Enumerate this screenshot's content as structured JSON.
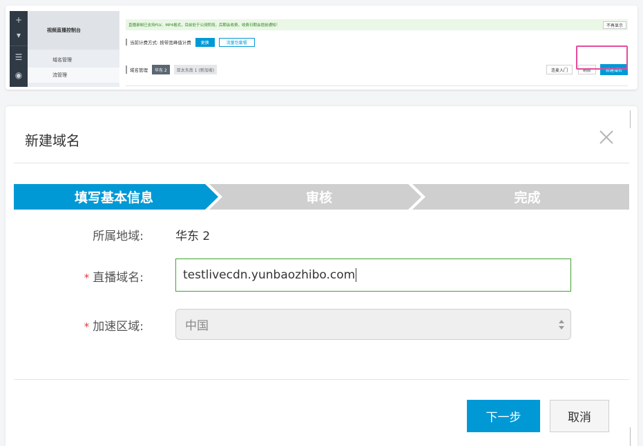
{
  "background_console": {
    "rail_icons": [
      "plus-icon",
      "caret-down-icon",
      "server-icon",
      "stream-icon"
    ],
    "sidebar": {
      "title": "视频直播控制台",
      "items": [
        {
          "label": "域名管理",
          "active": false
        },
        {
          "label": "流管理",
          "active": true
        }
      ]
    },
    "notice": {
      "text": "直播录制已支持FLV、MP4格式，目前处于公测阶段，后期会收费，收费日期会提前通知！",
      "dismiss_label": "不再显示"
    },
    "billing": {
      "text": "当前计费方式: 按带宽峰值计费",
      "change_label": "更换",
      "package_label": "流量包套餐"
    },
    "domain_tabs": {
      "title": "域名管理",
      "regions": [
        {
          "label": "华东 2",
          "active": true
        },
        {
          "label": "亚太东南 1 (新加坡)",
          "active": false
        }
      ]
    },
    "actions": {
      "connect_label": "连麦入门",
      "refresh_label": "刷新",
      "new_domain_label": "新建域名"
    },
    "colors": {
      "primary": "#0099d6",
      "highlight": "#e54b9a",
      "notice_bg": "#eaf6e6",
      "notice_text": "#2f8a1e"
    }
  },
  "dialog": {
    "title": "新建域名",
    "close_icon": "close-icon",
    "steps": [
      {
        "label": "填写基本信息",
        "active": true
      },
      {
        "label": "审核",
        "active": false
      },
      {
        "label": "完成",
        "active": false
      }
    ],
    "form": {
      "region_label": "所属地域:",
      "region_value": "华东 2",
      "domain_label": "直播域名:",
      "domain_value": "testlivecdn.yunbaozhibo.com",
      "acceleration_label": "加速区域:",
      "acceleration_value": "中国",
      "required_mark": "*"
    },
    "buttons": {
      "next_label": "下一步",
      "cancel_label": "取消"
    },
    "colors": {
      "step_active": "#0099d6",
      "step_inactive": "#cfcfcf",
      "input_focus_border": "#3fa32f",
      "required": "#e4393c"
    }
  }
}
